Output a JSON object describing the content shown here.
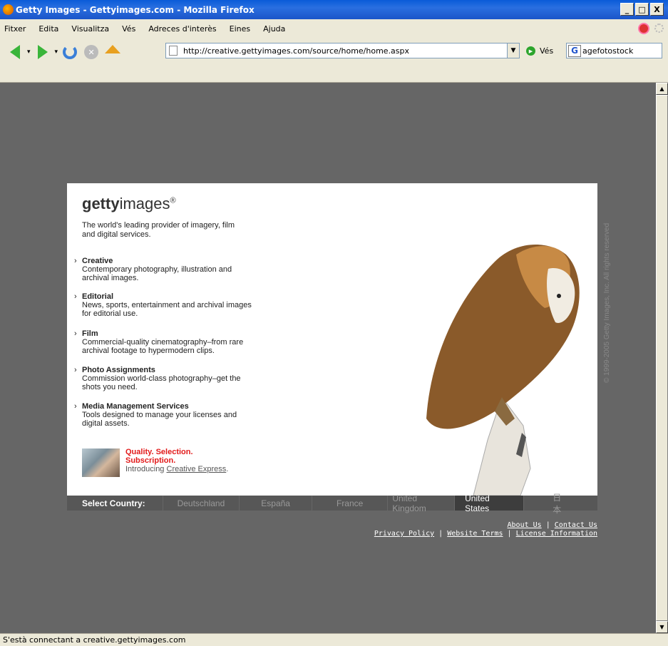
{
  "window": {
    "title": "Getty Images - Gettyimages.com - Mozilla Firefox",
    "controls": [
      "_",
      "□",
      "X"
    ]
  },
  "menu": [
    "Fitxer",
    "Edita",
    "Visualitza",
    "Vés",
    "Adreces d'interès",
    "Eines",
    "Ajuda"
  ],
  "toolbar": {
    "url": "http://creative.gettyimages.com/source/home/home.aspx",
    "go_label": "Vés",
    "search_value": "agefotostock"
  },
  "page": {
    "logo_bold": "getty",
    "logo_light": "images",
    "logo_mark": "®",
    "tagline": "The world's leading provider of imagery, film and digital services.",
    "services": [
      {
        "title": "Creative",
        "desc": "Contemporary photography, illustration and archival images."
      },
      {
        "title": "Editorial",
        "desc": "News, sports, entertainment and archival images for editorial use."
      },
      {
        "title": "Film",
        "desc": "Commercial-quality cinematography–from rare archival footage to hypermodern clips."
      },
      {
        "title": "Photo Assignments",
        "desc": "Commission world-class photography–get the shots you need."
      },
      {
        "title": "Media Management Services",
        "desc": "Tools designed to manage your licenses and digital assets."
      }
    ],
    "promo_line1": "Quality. Selection.",
    "promo_line2": "Subscription.",
    "promo_intro": "Introducing",
    "promo_link": "Creative Express",
    "promo_period": ".",
    "copyright": "© 1999-2005 Getty Images, Inc. All rights reserved",
    "country_label": "Select Country:",
    "countries": [
      "Deutschland",
      "España",
      "France",
      "United Kingdom",
      "United States",
      "日本"
    ],
    "active_country": "United States",
    "footer_row1": [
      "About Us",
      "Contact Us"
    ],
    "footer_row2": [
      "Privacy Policy",
      "Website Terms",
      "License Information"
    ],
    "footer_sep": "|"
  },
  "status": "S'està connectant a creative.gettyimages.com"
}
